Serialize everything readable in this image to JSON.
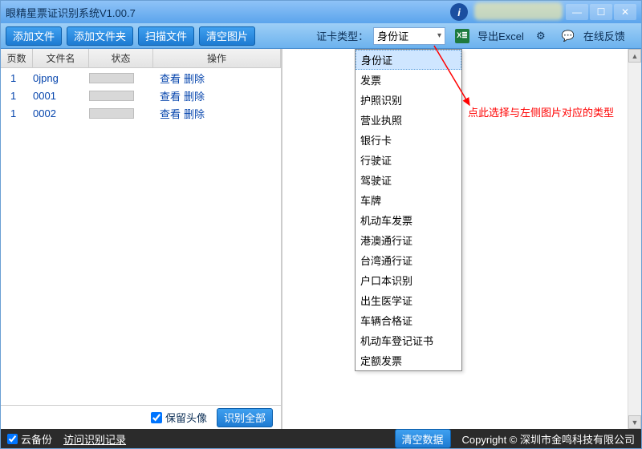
{
  "titlebar": {
    "title": "眼精星票证识别系统V1.00.7"
  },
  "window_controls": {
    "min": "—",
    "max": "☐",
    "close": "✕"
  },
  "toolbar": {
    "add_file": "添加文件",
    "add_folder": "添加文件夹",
    "scan_file": "扫描文件",
    "clear_image": "清空图片",
    "card_type_label": "证卡类型：",
    "selected_type": "身份证",
    "export_excel": "导出Excel",
    "feedback": "在线反馈"
  },
  "grid": {
    "headers": {
      "page": "页数",
      "name": "文件名",
      "status": "状态",
      "op": "操作"
    },
    "rows": [
      {
        "page": "1",
        "name": "0jpng",
        "view": "查看",
        "delete": "删除"
      },
      {
        "page": "1",
        "name": "0001",
        "view": "查看",
        "delete": "删除"
      },
      {
        "page": "1",
        "name": "0002",
        "view": "查看",
        "delete": "删除"
      }
    ]
  },
  "left_bottom": {
    "keep_avatar": "保留头像",
    "recognize_all": "识别全部"
  },
  "dropdown": {
    "items": [
      "身份证",
      "发票",
      "护照识别",
      "营业执照",
      "银行卡",
      "行驶证",
      "驾驶证",
      "车牌",
      "机动车发票",
      "港澳通行证",
      "台湾通行证",
      "户口本识别",
      "出生医学证",
      "车辆合格证",
      "机动车登记证书",
      "定额发票"
    ],
    "selected_index": 0
  },
  "annotation": "点此选择与左侧图片对应的类型",
  "statusbar": {
    "cloud_backup": "云备份",
    "visit_records": "访问识别记录",
    "clear_data": "清空数据",
    "copyright": "Copyright © 深圳市金鸣科技有限公司"
  }
}
